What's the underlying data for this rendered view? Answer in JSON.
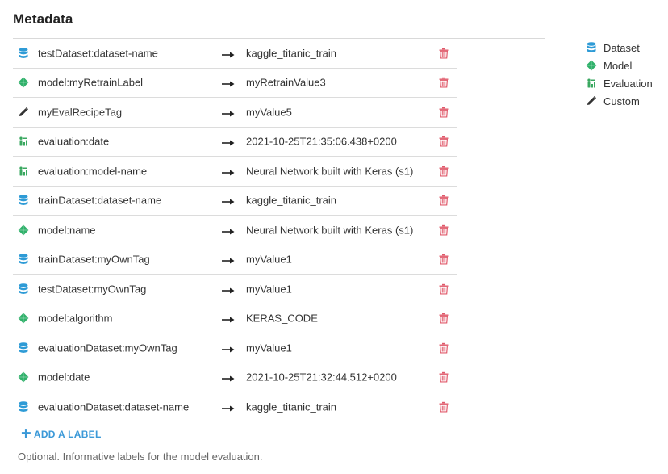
{
  "section": {
    "title": "Metadata",
    "add_label": "ADD A LABEL",
    "help_text": "Optional. Informative labels for the model evaluation."
  },
  "colors": {
    "dataset": "#2e9bd6",
    "model": "#2fb16a",
    "evaluation": "#3aa860",
    "custom": "#333333",
    "delete": "#e0596a",
    "link": "#3b99d8"
  },
  "rows": [
    {
      "icon": "database-icon",
      "key": "testDataset:dataset-name",
      "value": "kaggle_titanic_train"
    },
    {
      "icon": "diamond-icon",
      "key": "model:myRetrainLabel",
      "value": "myRetrainValue3"
    },
    {
      "icon": "pencil-icon",
      "key": "myEvalRecipeTag",
      "value": "myValue5"
    },
    {
      "icon": "evaluation-icon",
      "key": "evaluation:date",
      "value": "2021-10-25T21:35:06.438+0200"
    },
    {
      "icon": "evaluation-icon",
      "key": "evaluation:model-name",
      "value": "Neural Network built with Keras (s1)"
    },
    {
      "icon": "database-icon",
      "key": "trainDataset:dataset-name",
      "value": "kaggle_titanic_train"
    },
    {
      "icon": "diamond-icon",
      "key": "model:name",
      "value": "Neural Network built with Keras (s1)"
    },
    {
      "icon": "database-icon",
      "key": "trainDataset:myOwnTag",
      "value": "myValue1"
    },
    {
      "icon": "database-icon",
      "key": "testDataset:myOwnTag",
      "value": "myValue1"
    },
    {
      "icon": "diamond-icon",
      "key": "model:algorithm",
      "value": "KERAS_CODE"
    },
    {
      "icon": "database-icon",
      "key": "evaluationDataset:myOwnTag",
      "value": "myValue1"
    },
    {
      "icon": "diamond-icon",
      "key": "model:date",
      "value": "2021-10-25T21:32:44.512+0200"
    },
    {
      "icon": "database-icon",
      "key": "evaluationDataset:dataset-name",
      "value": "kaggle_titanic_train"
    }
  ],
  "legend": [
    {
      "icon": "database-icon",
      "label": "Dataset"
    },
    {
      "icon": "diamond-icon",
      "label": "Model"
    },
    {
      "icon": "evaluation-icon",
      "label": "Evaluation"
    },
    {
      "icon": "pencil-icon",
      "label": "Custom"
    }
  ]
}
